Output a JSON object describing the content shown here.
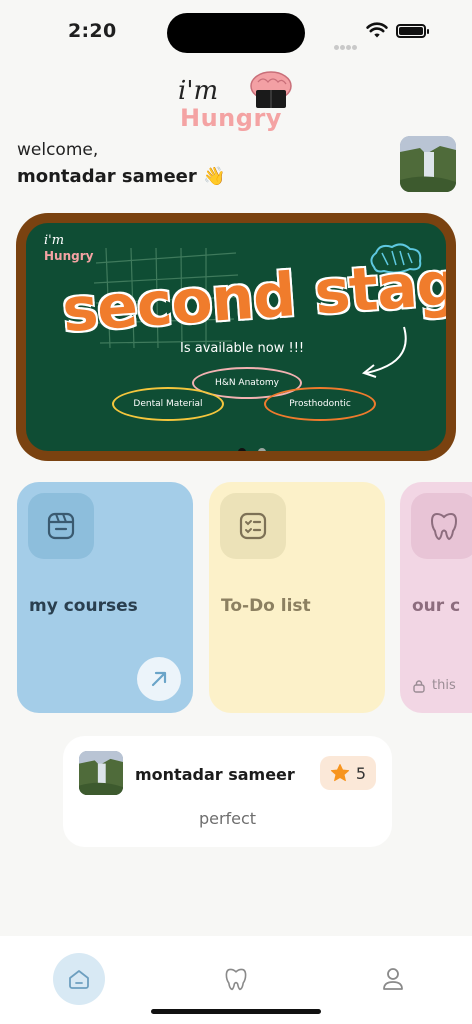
{
  "status_bar": {
    "time": "2:20"
  },
  "logo": {
    "line1": "i'm",
    "line2": "Hungry"
  },
  "header": {
    "greeting": "welcome,",
    "user_name": "montadar sameer 👋"
  },
  "banner": {
    "logo_line1": "i'm",
    "logo_line2": "Hungry",
    "headline": "second stage",
    "subtitle": "Is available now !!!",
    "subjects": [
      "H&N Anatomy",
      "Dental Material",
      "Prosthodontic"
    ],
    "page_indicator": {
      "total": 2,
      "active": 1
    }
  },
  "cards": [
    {
      "label": "my courses",
      "bg": "#a4cde8",
      "icon_bg": "#8dbedc",
      "color": "#2a3f4f",
      "icon": "archive-icon"
    },
    {
      "label": "To-Do list",
      "bg": "#fcf1c9",
      "icon_bg": "#ece2b8",
      "color": "#8c8061",
      "icon": "checklist-icon"
    },
    {
      "label": "our c",
      "bg": "#f2d6e4",
      "icon_bg": "#e8c4d6",
      "color": "#8d6d7e",
      "icon": "tooth-icon",
      "lock_text": "this"
    }
  ],
  "review": {
    "name": "montadar sameer",
    "rating": "5",
    "comment": "perfect"
  },
  "tabbar": {
    "active": "home"
  },
  "colors": {
    "accent_blue": "#a4cde8",
    "star": "#f7941d",
    "chalkboard": "#0f4d34",
    "frame": "#7a4210"
  }
}
